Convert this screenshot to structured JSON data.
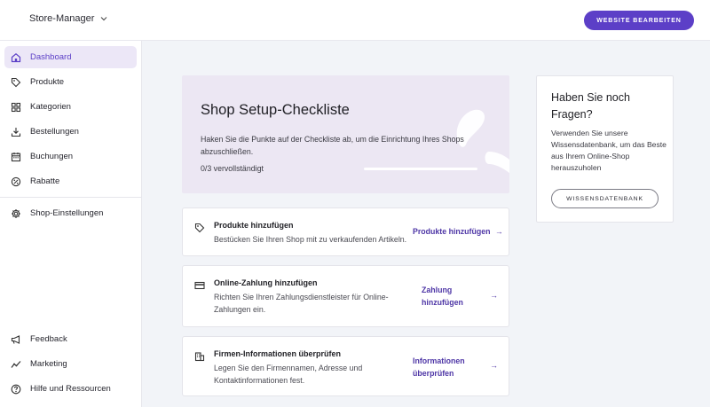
{
  "header": {
    "store_switcher": "Store-Manager",
    "edit_website_button": "WEBSITE BEARBEITEN"
  },
  "sidebar": {
    "items": [
      {
        "label": "Dashboard",
        "icon": "home-icon",
        "active": true
      },
      {
        "label": "Produkte",
        "icon": "tag-icon"
      },
      {
        "label": "Kategorien",
        "icon": "grid-icon"
      },
      {
        "label": "Bestellungen",
        "icon": "download-tray-icon"
      },
      {
        "label": "Buchungen",
        "icon": "calendar-icon"
      },
      {
        "label": "Rabatte",
        "icon": "discount-icon"
      },
      {
        "label": "Shop-Einstellungen",
        "icon": "gear-icon"
      }
    ],
    "bottom_items": [
      {
        "label": "Feedback",
        "icon": "megaphone-icon"
      },
      {
        "label": "Marketing",
        "icon": "trend-icon"
      },
      {
        "label": "Hilfe und Ressourcen",
        "icon": "help-circle-icon"
      }
    ]
  },
  "checklist": {
    "title": "Shop Setup-Checkliste",
    "description": "Haken Sie die Punkte auf der Checkliste ab, um die Einrichtung Ihres Shops abzuschließen.",
    "progress_text": "0/3 vervollständigt",
    "progress_fraction": 0
  },
  "tasks": [
    {
      "icon": "tag-icon",
      "title": "Produkte hinzufügen",
      "description": "Bestücken Sie Ihren Shop mit zu verkaufenden Artikeln.",
      "link_line1": "Produkte hinzufügen",
      "link_line2": "",
      "arrow": "→"
    },
    {
      "icon": "credit-card-icon",
      "title": "Online-Zahlung hinzufügen",
      "description": "Richten Sie Ihren Zahlungsdienstleister für Online-Zahlungen ein.",
      "link_line1": "Zahlung",
      "link_line2": "hinzufügen",
      "arrow": "→"
    },
    {
      "icon": "building-icon",
      "title": "Firmen-Informationen überprüfen",
      "description": "Legen Sie den Firmennamen, Adresse und Kontaktinformationen fest.",
      "link_line1": "Informationen",
      "link_line2": "überprüfen",
      "arrow": "→"
    }
  ],
  "help_card": {
    "title": "Haben Sie noch Fragen?",
    "text": "Verwenden Sie unsere Wissensdatenbank, um das Beste aus Ihrem Online-Shop herauszuholen",
    "button": "WISSENSDATENBANK"
  },
  "colors": {
    "accent": "#5c3fc7",
    "link": "#4e36a6",
    "hero_background": "#ece7f3",
    "main_background": "#f2f4f8"
  }
}
